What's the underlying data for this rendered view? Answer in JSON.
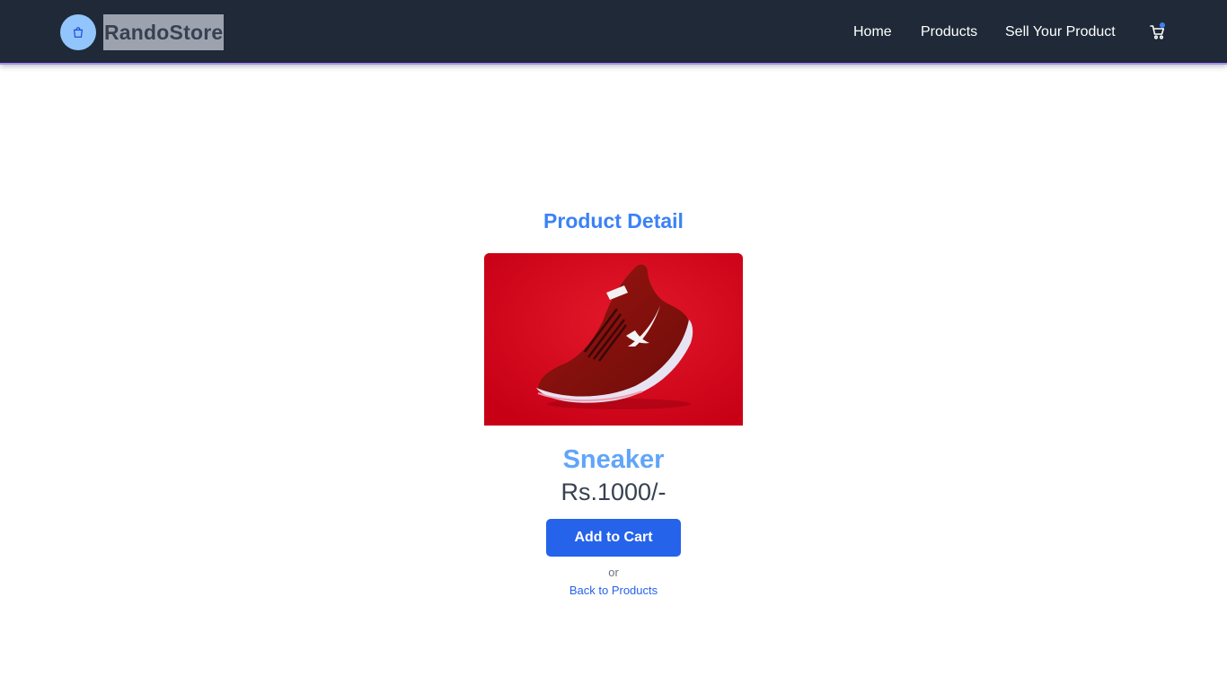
{
  "header": {
    "brand_name": "RandoStore",
    "brand_icon": "shopping-bag-icon",
    "nav": [
      {
        "label": "Home"
      },
      {
        "label": "Products"
      },
      {
        "label": "Sell Your Product"
      }
    ],
    "cart_icon": "cart-icon",
    "colors": {
      "navbar": "#1f2937",
      "accent_border": "#a78bfa",
      "brand_circle": "#93c5fd",
      "cart_badge": "#3b82f6"
    }
  },
  "main": {
    "section_title": "Product Detail",
    "product": {
      "image": "red-sneaker-photo",
      "name": "Sneaker",
      "price": "Rs.1000/-"
    },
    "add_to_cart_label": "Add to Cart",
    "or_text": "or",
    "back_link_label": "Back to Products",
    "colors": {
      "title": "#3b82f6",
      "name": "#60a5fa",
      "button": "#2563eb",
      "link": "#2563eb"
    }
  }
}
